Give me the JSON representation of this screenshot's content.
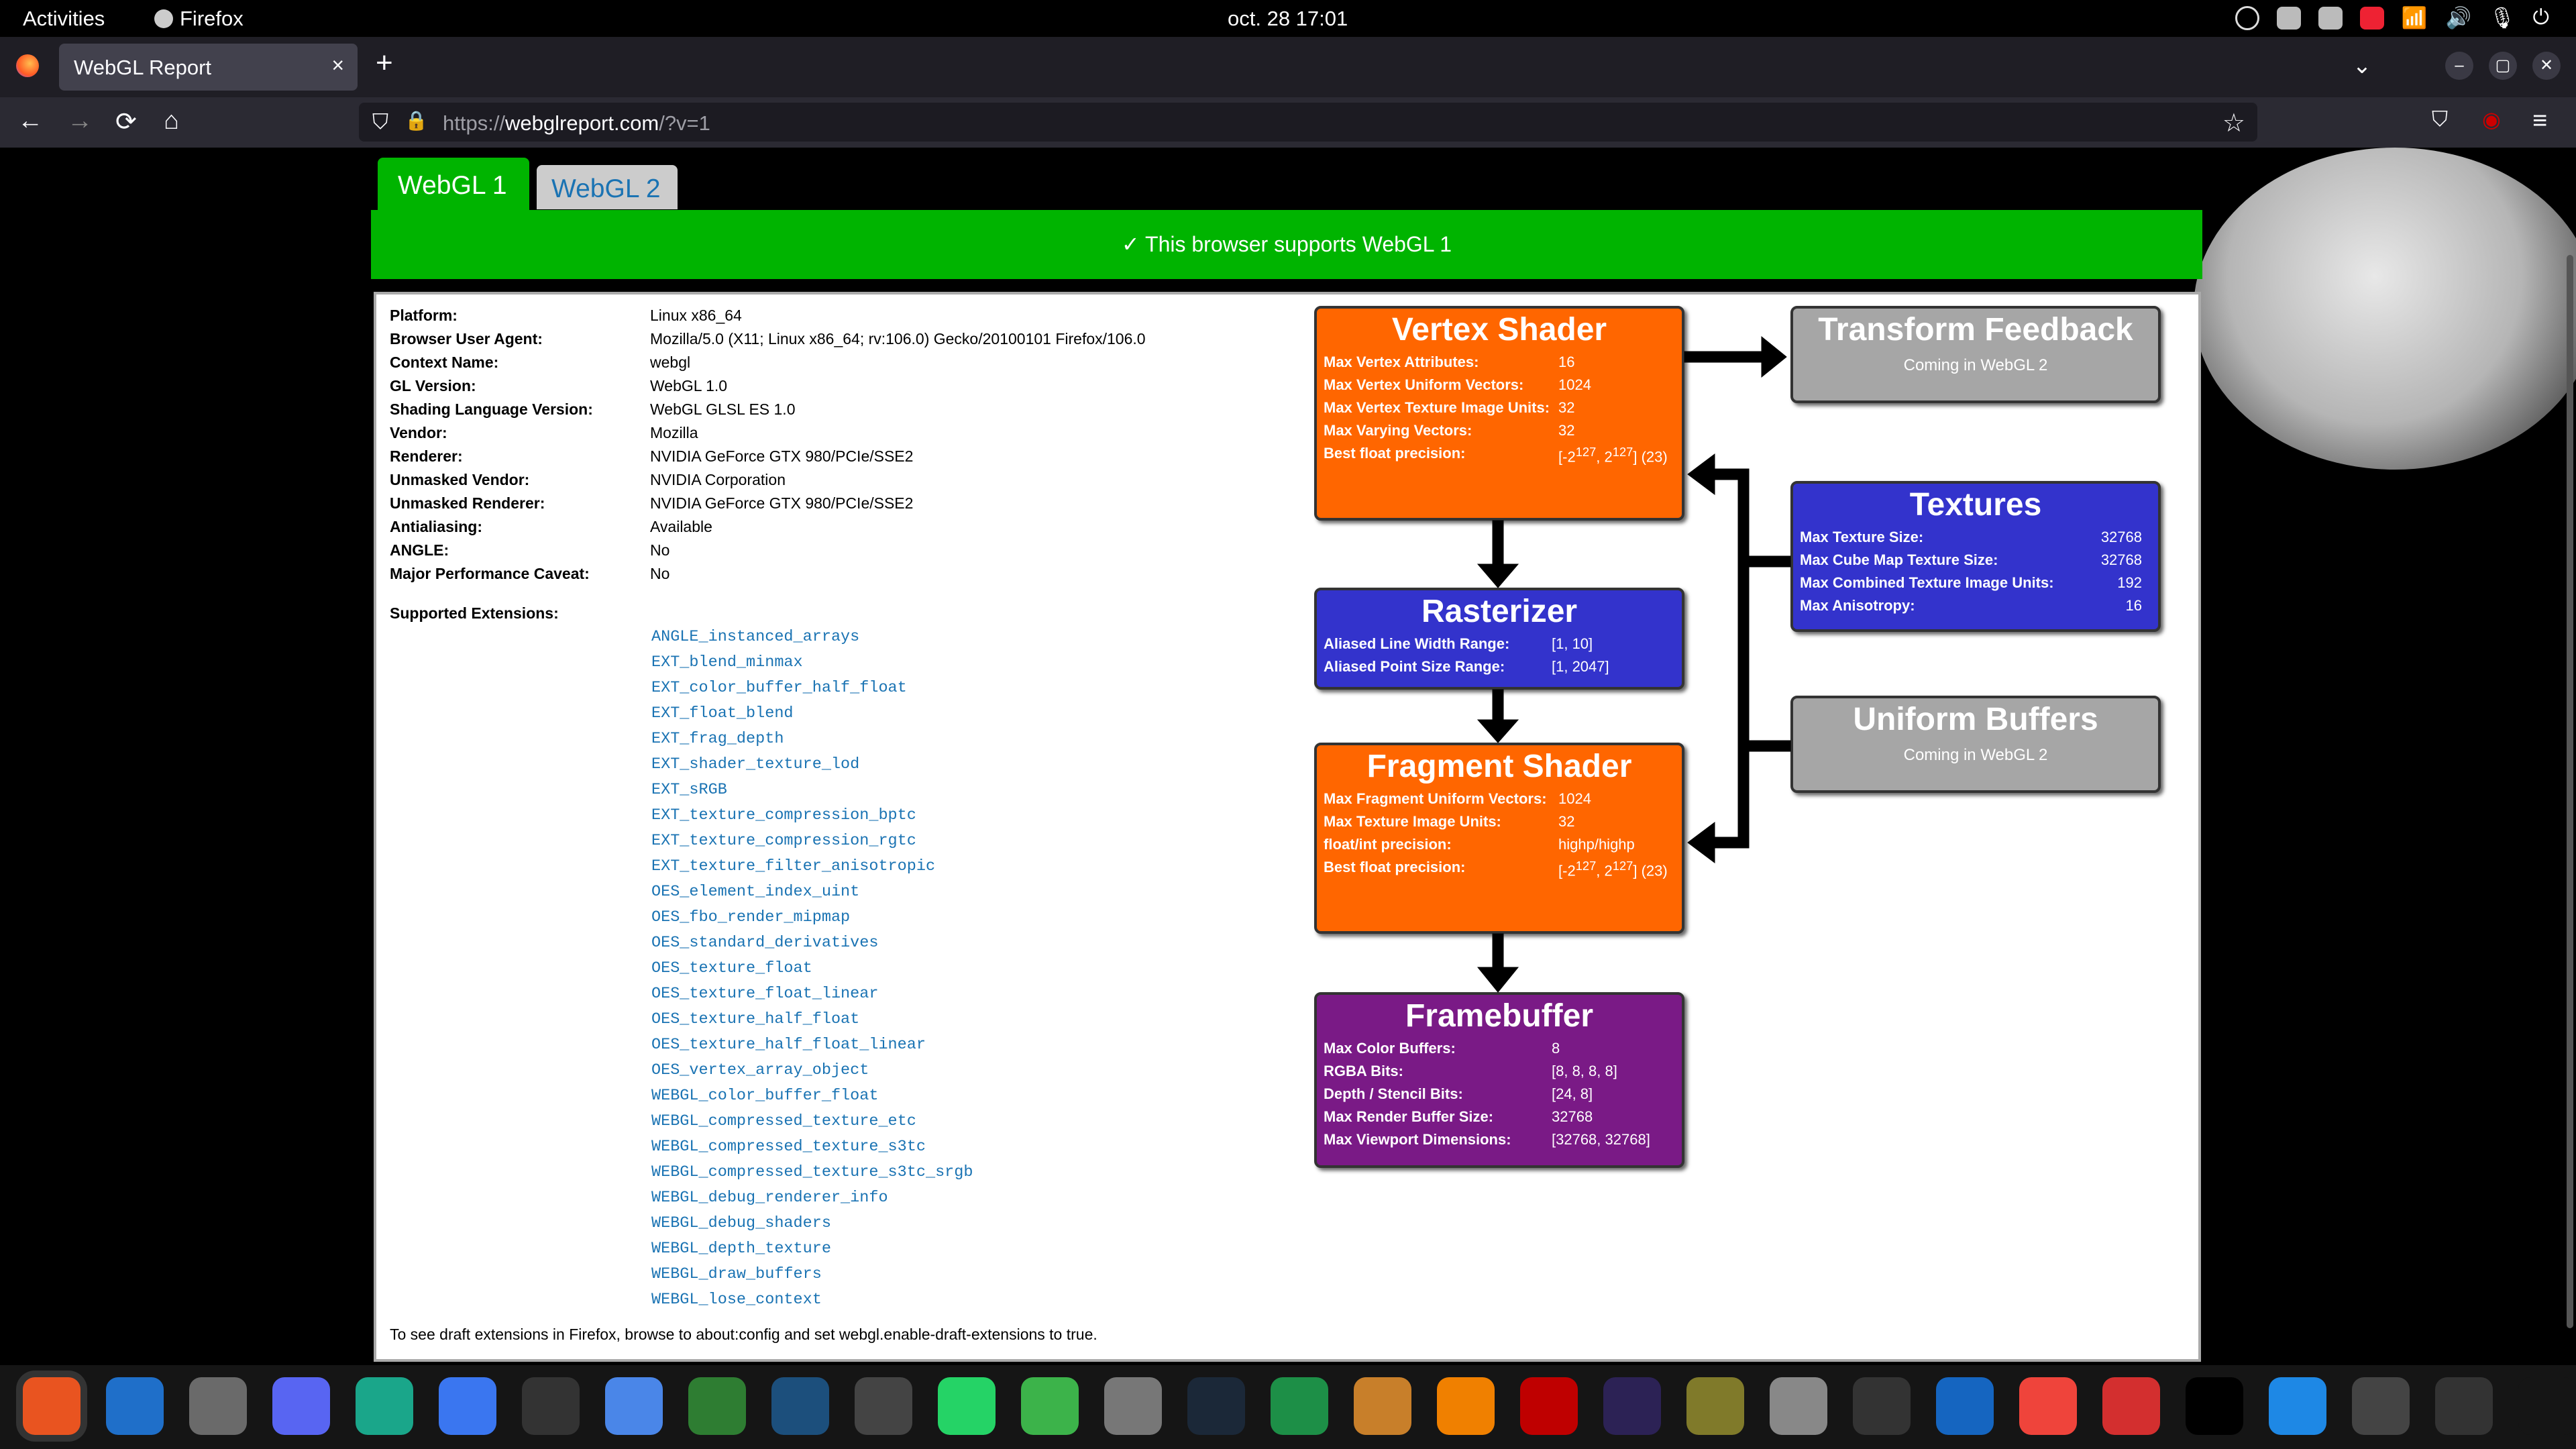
{
  "topbar": {
    "activities": "Activities",
    "app": "Firefox",
    "clock": "oct. 28  17:01"
  },
  "browser": {
    "tab_title": "WebGL Report",
    "tab_close": "×",
    "new_tab": "+",
    "url_scheme": "https://",
    "url_host": "webglreport.com",
    "url_path": "/?v=1",
    "back": "←",
    "forward": "→",
    "reload": "⟳",
    "home": "⌂",
    "shield": "⛉",
    "lock": "🔒",
    "star": "☆",
    "pocket": "⛉",
    "ublock": "◉",
    "menu": "≡",
    "tabs_list": "⌄",
    "window_minimize": "–",
    "window_maximize": "▢",
    "window_close": "✕"
  },
  "page": {
    "tabs": [
      "WebGL 1",
      "WebGL 2"
    ],
    "support_message": "✓ This browser supports WebGL 1",
    "info": [
      {
        "k": "Platform:",
        "v": "Linux x86_64"
      },
      {
        "k": "Browser User Agent:",
        "v": "Mozilla/5.0 (X11; Linux x86_64; rv:106.0) Gecko/20100101 Firefox/106.0"
      },
      {
        "k": "Context Name:",
        "v": "webgl"
      },
      {
        "k": "GL Version:",
        "v": "WebGL 1.0"
      },
      {
        "k": "Shading Language Version:",
        "v": "WebGL GLSL ES 1.0"
      },
      {
        "k": "Vendor:",
        "v": "Mozilla"
      },
      {
        "k": "Renderer:",
        "v": "NVIDIA GeForce GTX 980/PCIe/SSE2"
      },
      {
        "k": "Unmasked Vendor:",
        "v": "NVIDIA Corporation"
      },
      {
        "k": "Unmasked Renderer:",
        "v": "NVIDIA GeForce GTX 980/PCIe/SSE2"
      },
      {
        "k": "Antialiasing:",
        "v": "Available"
      },
      {
        "k": "ANGLE:",
        "v": "No"
      },
      {
        "k": "Major Performance Caveat:",
        "v": "No"
      }
    ],
    "extensions_label": "Supported Extensions:",
    "extensions": [
      "ANGLE_instanced_arrays",
      "EXT_blend_minmax",
      "EXT_color_buffer_half_float",
      "EXT_float_blend",
      "EXT_frag_depth",
      "EXT_shader_texture_lod",
      "EXT_sRGB",
      "EXT_texture_compression_bptc",
      "EXT_texture_compression_rgtc",
      "EXT_texture_filter_anisotropic",
      "OES_element_index_uint",
      "OES_fbo_render_mipmap",
      "OES_standard_derivatives",
      "OES_texture_float",
      "OES_texture_float_linear",
      "OES_texture_half_float",
      "OES_texture_half_float_linear",
      "OES_vertex_array_object",
      "WEBGL_color_buffer_float",
      "WEBGL_compressed_texture_etc",
      "WEBGL_compressed_texture_s3tc",
      "WEBGL_compressed_texture_s3tc_srgb",
      "WEBGL_debug_renderer_info",
      "WEBGL_debug_shaders",
      "WEBGL_depth_texture",
      "WEBGL_draw_buffers",
      "WEBGL_lose_context"
    ],
    "note": "To see draft extensions in Firefox, browse to about:config and set webgl.enable-draft-extensions to true."
  },
  "pipeline": {
    "vertex": {
      "title": "Vertex Shader",
      "rows": [
        [
          "Max Vertex Attributes:",
          "16"
        ],
        [
          "Max Vertex Uniform Vectors:",
          "1024"
        ],
        [
          "Max Vertex Texture Image Units:",
          "32"
        ],
        [
          "Max Varying Vectors:",
          "32"
        ],
        [
          "Best float precision:",
          "[-2^127, 2^127] (23)"
        ]
      ]
    },
    "rasterizer": {
      "title": "Rasterizer",
      "rows": [
        [
          "Aliased Line Width Range:",
          "[1, 10]"
        ],
        [
          "Aliased Point Size Range:",
          "[1, 2047]"
        ]
      ]
    },
    "fragment": {
      "title": "Fragment Shader",
      "rows": [
        [
          "Max Fragment Uniform Vectors:",
          "1024"
        ],
        [
          "Max Texture Image Units:",
          "32"
        ],
        [
          "float/int precision:",
          "highp/highp"
        ],
        [
          "Best float precision:",
          "[-2^127, 2^127] (23)"
        ]
      ]
    },
    "framebuffer": {
      "title": "Framebuffer",
      "rows": [
        [
          "Max Color Buffers:",
          "8"
        ],
        [
          "RGBA Bits:",
          "[8, 8, 8, 8]"
        ],
        [
          "Depth / Stencil Bits:",
          "[24, 8]"
        ],
        [
          "Max Render Buffer Size:",
          "32768"
        ],
        [
          "Max Viewport Dimensions:",
          "[32768, 32768]"
        ]
      ]
    },
    "transform": {
      "title": "Transform Feedback",
      "sub": "Coming in WebGL 2"
    },
    "textures": {
      "title": "Textures",
      "rows": [
        [
          "Max Texture Size:",
          "32768"
        ],
        [
          "Max Cube Map Texture Size:",
          "32768"
        ],
        [
          "Max Combined Texture Image Units:",
          "192"
        ],
        [
          "Max Anisotropy:",
          "16"
        ]
      ]
    },
    "uniform": {
      "title": "Uniform Buffers",
      "sub": "Coming in WebGL 2"
    }
  },
  "colors": {
    "orange": "#ff6600",
    "blue": "#3333cc",
    "purple": "#7a1a86",
    "gray": "#a6a6a6",
    "green": "#00b400",
    "link": "#1a73b3"
  },
  "dock": [
    "firefox-icon",
    "thunderbird-icon",
    "files-icon",
    "discord-icon",
    "gitkraken-icon",
    "signal-icon",
    "terminal-icon",
    "text-editor-icon",
    "grid-app-icon",
    "mysql-workbench-icon",
    "obs-icon",
    "whatsapp-icon",
    "qc-icon",
    "calculator-icon",
    "steam-icon",
    "spreadsheet-icon",
    "cube-icon",
    "vlc-icon",
    "filezilla-icon",
    "eclipse-icon",
    "gimp-icon",
    "trash-icon",
    "davinci-icon",
    "document-icon",
    "anydesk-icon",
    "color-grid-icon",
    "intellij-icon",
    "monitor-icon",
    "disk-icon",
    "drive-icon",
    "apps-grid-icon"
  ]
}
